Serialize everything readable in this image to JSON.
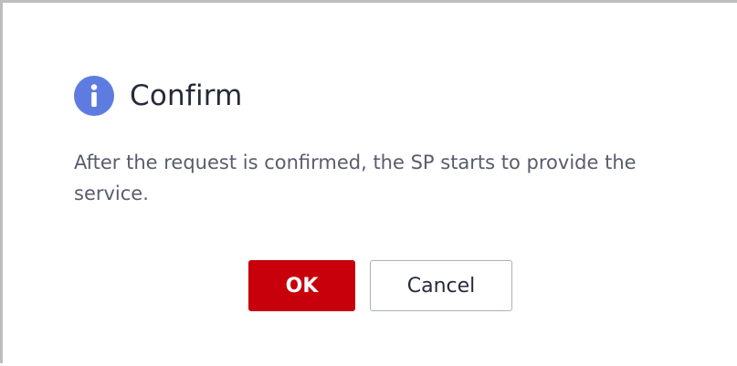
{
  "dialog": {
    "icon": "info-icon",
    "title": "Confirm",
    "message": "After the request is confirmed, the SP starts to provide the service.",
    "ok_label": "OK",
    "cancel_label": "Cancel"
  },
  "colors": {
    "icon_bg": "#5e7ce0",
    "primary_button": "#c7000b",
    "title_text": "#252b3a",
    "body_text": "#575d6c",
    "cancel_border": "#adb0b8"
  }
}
